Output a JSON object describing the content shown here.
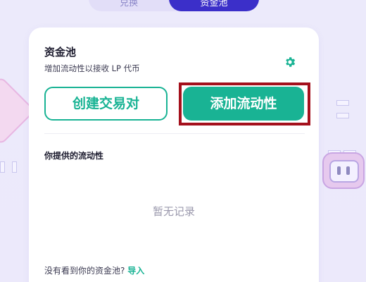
{
  "tabs": [
    {
      "label": "兑换"
    },
    {
      "label": "资金池"
    }
  ],
  "pool": {
    "title": "资金池",
    "subtitle": "增加流动性以接收 LP 代币",
    "create_pair_label": "创建交易对",
    "add_liquidity_label": "添加流动性",
    "your_liquidity_label": "你提供的流动性",
    "empty_text": "暂无记录",
    "footer_text": "没有看到你的资金池?",
    "import_label": "导入"
  },
  "colors": {
    "accent": "#19b394",
    "tab_active": "#3b2fc9",
    "highlight_border": "#a4101c"
  },
  "icons": {
    "settings": "gear-icon"
  }
}
